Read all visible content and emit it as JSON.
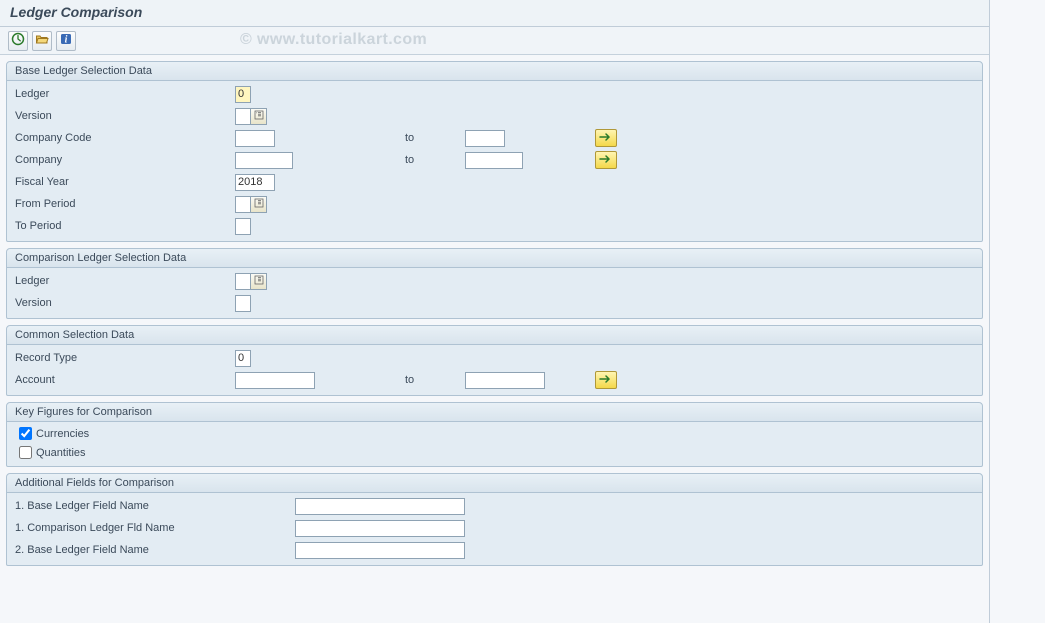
{
  "page_title": "Ledger Comparison",
  "watermark": "© www.tutorialkart.com",
  "toolbar": {
    "execute_title": "Execute",
    "variants_title": "Get Variant",
    "info_title": "Information"
  },
  "groups": {
    "base_ledger": {
      "title": "Base Ledger Selection Data",
      "ledger_label": "Ledger",
      "ledger_value": "0",
      "version_label": "Version",
      "version_value": "",
      "company_code_label": "Company Code",
      "company_code_from": "",
      "company_code_to": "",
      "company_label": "Company",
      "company_from": "",
      "company_to": "",
      "fiscal_year_label": "Fiscal Year",
      "fiscal_year_value": "2018",
      "from_period_label": "From Period",
      "from_period_value": "",
      "to_period_label": "To Period",
      "to_period_value": "",
      "to_text": "to"
    },
    "comparison_ledger": {
      "title": "Comparison Ledger Selection Data",
      "ledger_label": "Ledger",
      "ledger_value": "",
      "version_label": "Version",
      "version_value": ""
    },
    "common": {
      "title": "Common Selection Data",
      "record_type_label": "Record Type",
      "record_type_value": "0",
      "account_label": "Account",
      "account_from": "",
      "account_to": "",
      "to_text": "to"
    },
    "key_figures": {
      "title": "Key Figures for Comparison",
      "currencies_label": "Currencies",
      "currencies_checked": true,
      "quantities_label": "Quantities",
      "quantities_checked": false
    },
    "additional": {
      "title": "Additional Fields for Comparison",
      "row1_label": "1. Base Ledger Field Name",
      "row1_value": "",
      "row2_label": "1. Comparison Ledger Fld Name",
      "row2_value": "",
      "row3_label": "2. Base Ledger Field Name",
      "row3_value": ""
    }
  }
}
